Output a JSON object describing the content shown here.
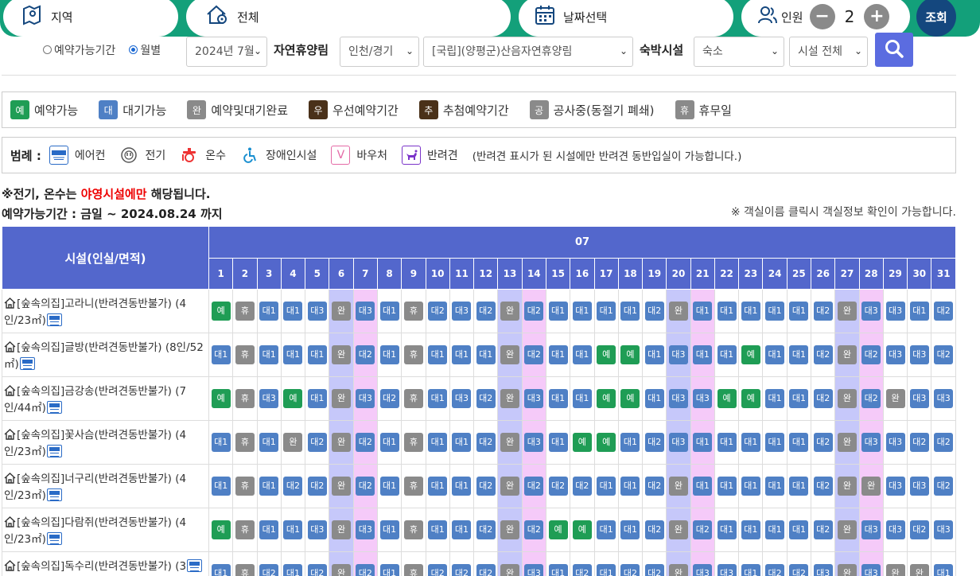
{
  "topbar": {
    "region_label": "지역",
    "all_label": "전체",
    "date_label": "날짜선택",
    "people_label": "인원",
    "people_count": "2",
    "search_label": "조회"
  },
  "filters": {
    "radio_period": "예약가능기간",
    "radio_month": "월별",
    "month_select": "2024년 7월",
    "forest_label": "자연휴양림",
    "region_select": "인천/경기",
    "forest_select": "[국립](양평군)산음자연휴양림",
    "lodging_label": "숙박시설",
    "lodging_select": "숙소",
    "facility_select": "시설 전체"
  },
  "status_legend": [
    {
      "mark": "예",
      "label": "예약가능",
      "color": "#1f9d55"
    },
    {
      "mark": "대",
      "label": "대기가능",
      "color": "#4f80c5"
    },
    {
      "mark": "완",
      "label": "예약및대기완료",
      "color": "#8a8a8a"
    },
    {
      "mark": "우",
      "label": "우선예약기간",
      "color": "#4a3119"
    },
    {
      "mark": "추",
      "label": "추첨예약기간",
      "color": "#4a3119"
    },
    {
      "mark": "공",
      "label": "공사중(동절기 폐쇄)",
      "color": "#8a8a8a"
    },
    {
      "mark": "휴",
      "label": "휴무일",
      "color": "#8a8a8a"
    }
  ],
  "legend": {
    "title": "범례 :",
    "items": [
      {
        "icon": "air-conditioner-icon",
        "label": "에어컨"
      },
      {
        "icon": "power-plug-icon",
        "label": "전기"
      },
      {
        "icon": "hot-water-icon",
        "label": "온수"
      },
      {
        "icon": "accessibility-icon",
        "label": "장애인시설"
      },
      {
        "icon": "voucher-icon",
        "label": "바우처",
        "mark": "V"
      },
      {
        "icon": "pet-icon",
        "label": "반려견"
      }
    ],
    "note": "(반려견 표시가 된 시설에만 반려견 동반입실이 가능합니다.)"
  },
  "notes": {
    "line1_a": "※전기, 온수는 ",
    "line1_red": "야영시설에만",
    "line1_b": " 해당됩니다.",
    "line2": "예약가능기간 : 금일 ~ 2024.08.24 까지",
    "line3": "※ 객실이름 클릭시 객실정보 확인이 가능합니다."
  },
  "table": {
    "facility_header": "시설(인실/면적)",
    "month": "07",
    "days": [
      "1",
      "2",
      "3",
      "4",
      "5",
      "6",
      "7",
      "8",
      "9",
      "10",
      "11",
      "12",
      "13",
      "14",
      "15",
      "16",
      "17",
      "18",
      "19",
      "20",
      "21",
      "22",
      "23",
      "24",
      "25",
      "26",
      "27",
      "28",
      "29",
      "30",
      "31"
    ],
    "saturdays": [
      "6",
      "13",
      "20",
      "27"
    ],
    "sundays": [
      "7",
      "14",
      "21",
      "28"
    ],
    "rows": [
      {
        "name": "[숲속의집]고라니(반려견동반불가) (4인/23㎡)",
        "cells": [
          "예",
          "휴",
          "대1",
          "대1",
          "대3",
          "완",
          "대3",
          "대1",
          "휴",
          "대2",
          "대3",
          "대2",
          "완",
          "대2",
          "대1",
          "대1",
          "대1",
          "대1",
          "대2",
          "완",
          "대1",
          "대1",
          "대1",
          "대1",
          "대1",
          "대2",
          "완",
          "대3",
          "대3",
          "대1",
          "대2"
        ]
      },
      {
        "name": "[숲속의집]글방(반려견동반불가) (8인/52㎡)",
        "cells": [
          "대1",
          "휴",
          "대1",
          "대1",
          "대1",
          "완",
          "대2",
          "대1",
          "휴",
          "대1",
          "대1",
          "대1",
          "완",
          "대2",
          "대1",
          "대1",
          "예",
          "예",
          "대1",
          "대3",
          "대1",
          "대1",
          "예",
          "대1",
          "대1",
          "대2",
          "완",
          "대2",
          "대3",
          "대3",
          "대2"
        ]
      },
      {
        "name": "[숲속의집]금강송(반려견동반불가) (7인/44㎡)",
        "cells": [
          "예",
          "휴",
          "대3",
          "예",
          "대1",
          "완",
          "대3",
          "대2",
          "휴",
          "대1",
          "대3",
          "대2",
          "완",
          "대3",
          "대1",
          "대1",
          "예",
          "예",
          "대1",
          "대3",
          "대3",
          "예",
          "예",
          "대1",
          "대1",
          "대2",
          "완",
          "대2",
          "완",
          "대3",
          "대3"
        ]
      },
      {
        "name": "[숲속의집]꽃사슴(반려견동반불가) (4인/23㎡)",
        "cells": [
          "대1",
          "휴",
          "대1",
          "완",
          "대2",
          "완",
          "대2",
          "대1",
          "휴",
          "대1",
          "대1",
          "대2",
          "완",
          "대3",
          "대1",
          "예",
          "예",
          "대1",
          "대2",
          "대3",
          "대1",
          "대1",
          "대1",
          "대1",
          "대1",
          "대2",
          "완",
          "대3",
          "대3",
          "대2",
          "대2"
        ]
      },
      {
        "name": "[숲속의집]너구리(반려견동반불가) (4인/23㎡)",
        "cells": [
          "대1",
          "휴",
          "대1",
          "대2",
          "대2",
          "완",
          "대2",
          "대1",
          "휴",
          "대1",
          "대1",
          "대2",
          "완",
          "대2",
          "대2",
          "대2",
          "대1",
          "대1",
          "대2",
          "완",
          "대1",
          "대1",
          "대1",
          "대1",
          "대1",
          "대2",
          "완",
          "완",
          "대3",
          "대3",
          "대2"
        ]
      },
      {
        "name": "[숲속의집]다람쥐(반려견동반불가) (4인/23㎡)",
        "cells": [
          "예",
          "휴",
          "대1",
          "대1",
          "대3",
          "완",
          "대3",
          "대1",
          "휴",
          "대1",
          "대1",
          "대2",
          "완",
          "대2",
          "예",
          "예",
          "대1",
          "대1",
          "대2",
          "완",
          "대2",
          "대1",
          "대1",
          "대1",
          "대1",
          "대2",
          "완",
          "대3",
          "대3",
          "대2",
          "대3"
        ]
      },
      {
        "name": "[숲속의집]독수리(반려견동반불가) (3",
        "cells": [
          "대1",
          "휴",
          "대2",
          "대1",
          "대2",
          "완",
          "대2",
          "대1",
          "휴",
          "대2",
          "대2",
          "대2",
          "완",
          "대3",
          "대1",
          "대2",
          "대1",
          "대2",
          "대2",
          "완",
          "대3",
          "대3",
          "대1",
          "대2",
          "대2",
          "대3",
          "완",
          "대3",
          "완",
          "완",
          "대1"
        ]
      }
    ]
  },
  "colors": {
    "topbar": "#13a07a",
    "header": "#5367cc",
    "available": "#1f9d55",
    "waiting": "#4f80c5",
    "done": "#8a8a8a",
    "saturday": "#c6c8fa",
    "sunday": "#f5caf9",
    "search": "#14477e"
  }
}
